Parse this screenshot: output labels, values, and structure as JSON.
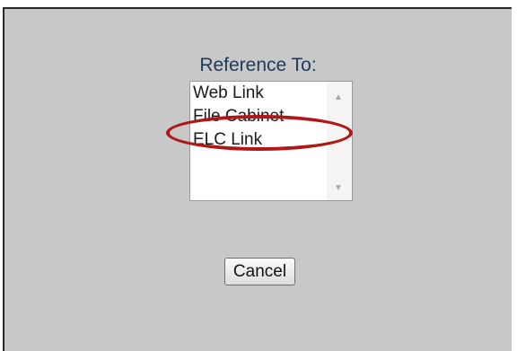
{
  "dialog": {
    "label": "Reference To:",
    "options": [
      "Web Link",
      "File Cabinet",
      "ELC Link"
    ],
    "highlighted_option": "File Cabinet",
    "highlight_color": "#b01818",
    "cancel_label": "Cancel"
  }
}
